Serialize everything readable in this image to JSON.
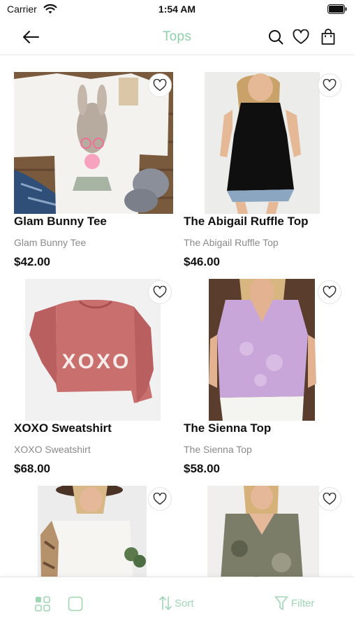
{
  "status_bar": {
    "carrier": "Carrier",
    "time": "1:54 AM"
  },
  "header": {
    "title": "Tops",
    "title_color": "#8fd0a9"
  },
  "icons": {
    "back": "back-arrow-icon",
    "search": "search-icon",
    "wishlist": "heart-icon",
    "bag": "shopping-bag-icon"
  },
  "products": [
    {
      "name": "Glam Bunny Tee",
      "subtitle": "Glam Bunny Tee",
      "price": "$42.00"
    },
    {
      "name": "The Abigail Ruffle Top",
      "subtitle": "The Abigail Ruffle Top",
      "price": "$46.00"
    },
    {
      "name": "XOXO Sweatshirt",
      "subtitle": "XOXO Sweatshirt",
      "price": "$68.00"
    },
    {
      "name": "The Sienna Top",
      "subtitle": "The Sienna Top",
      "price": "$58.00"
    },
    {
      "name": "",
      "subtitle": "",
      "price": ""
    },
    {
      "name": "",
      "subtitle": "",
      "price": ""
    }
  ],
  "sweatshirt_print": "XOXO",
  "bottom_bar": {
    "sort_label": "Sort",
    "filter_label": "Filter",
    "accent_color": "#9fd6b4"
  }
}
